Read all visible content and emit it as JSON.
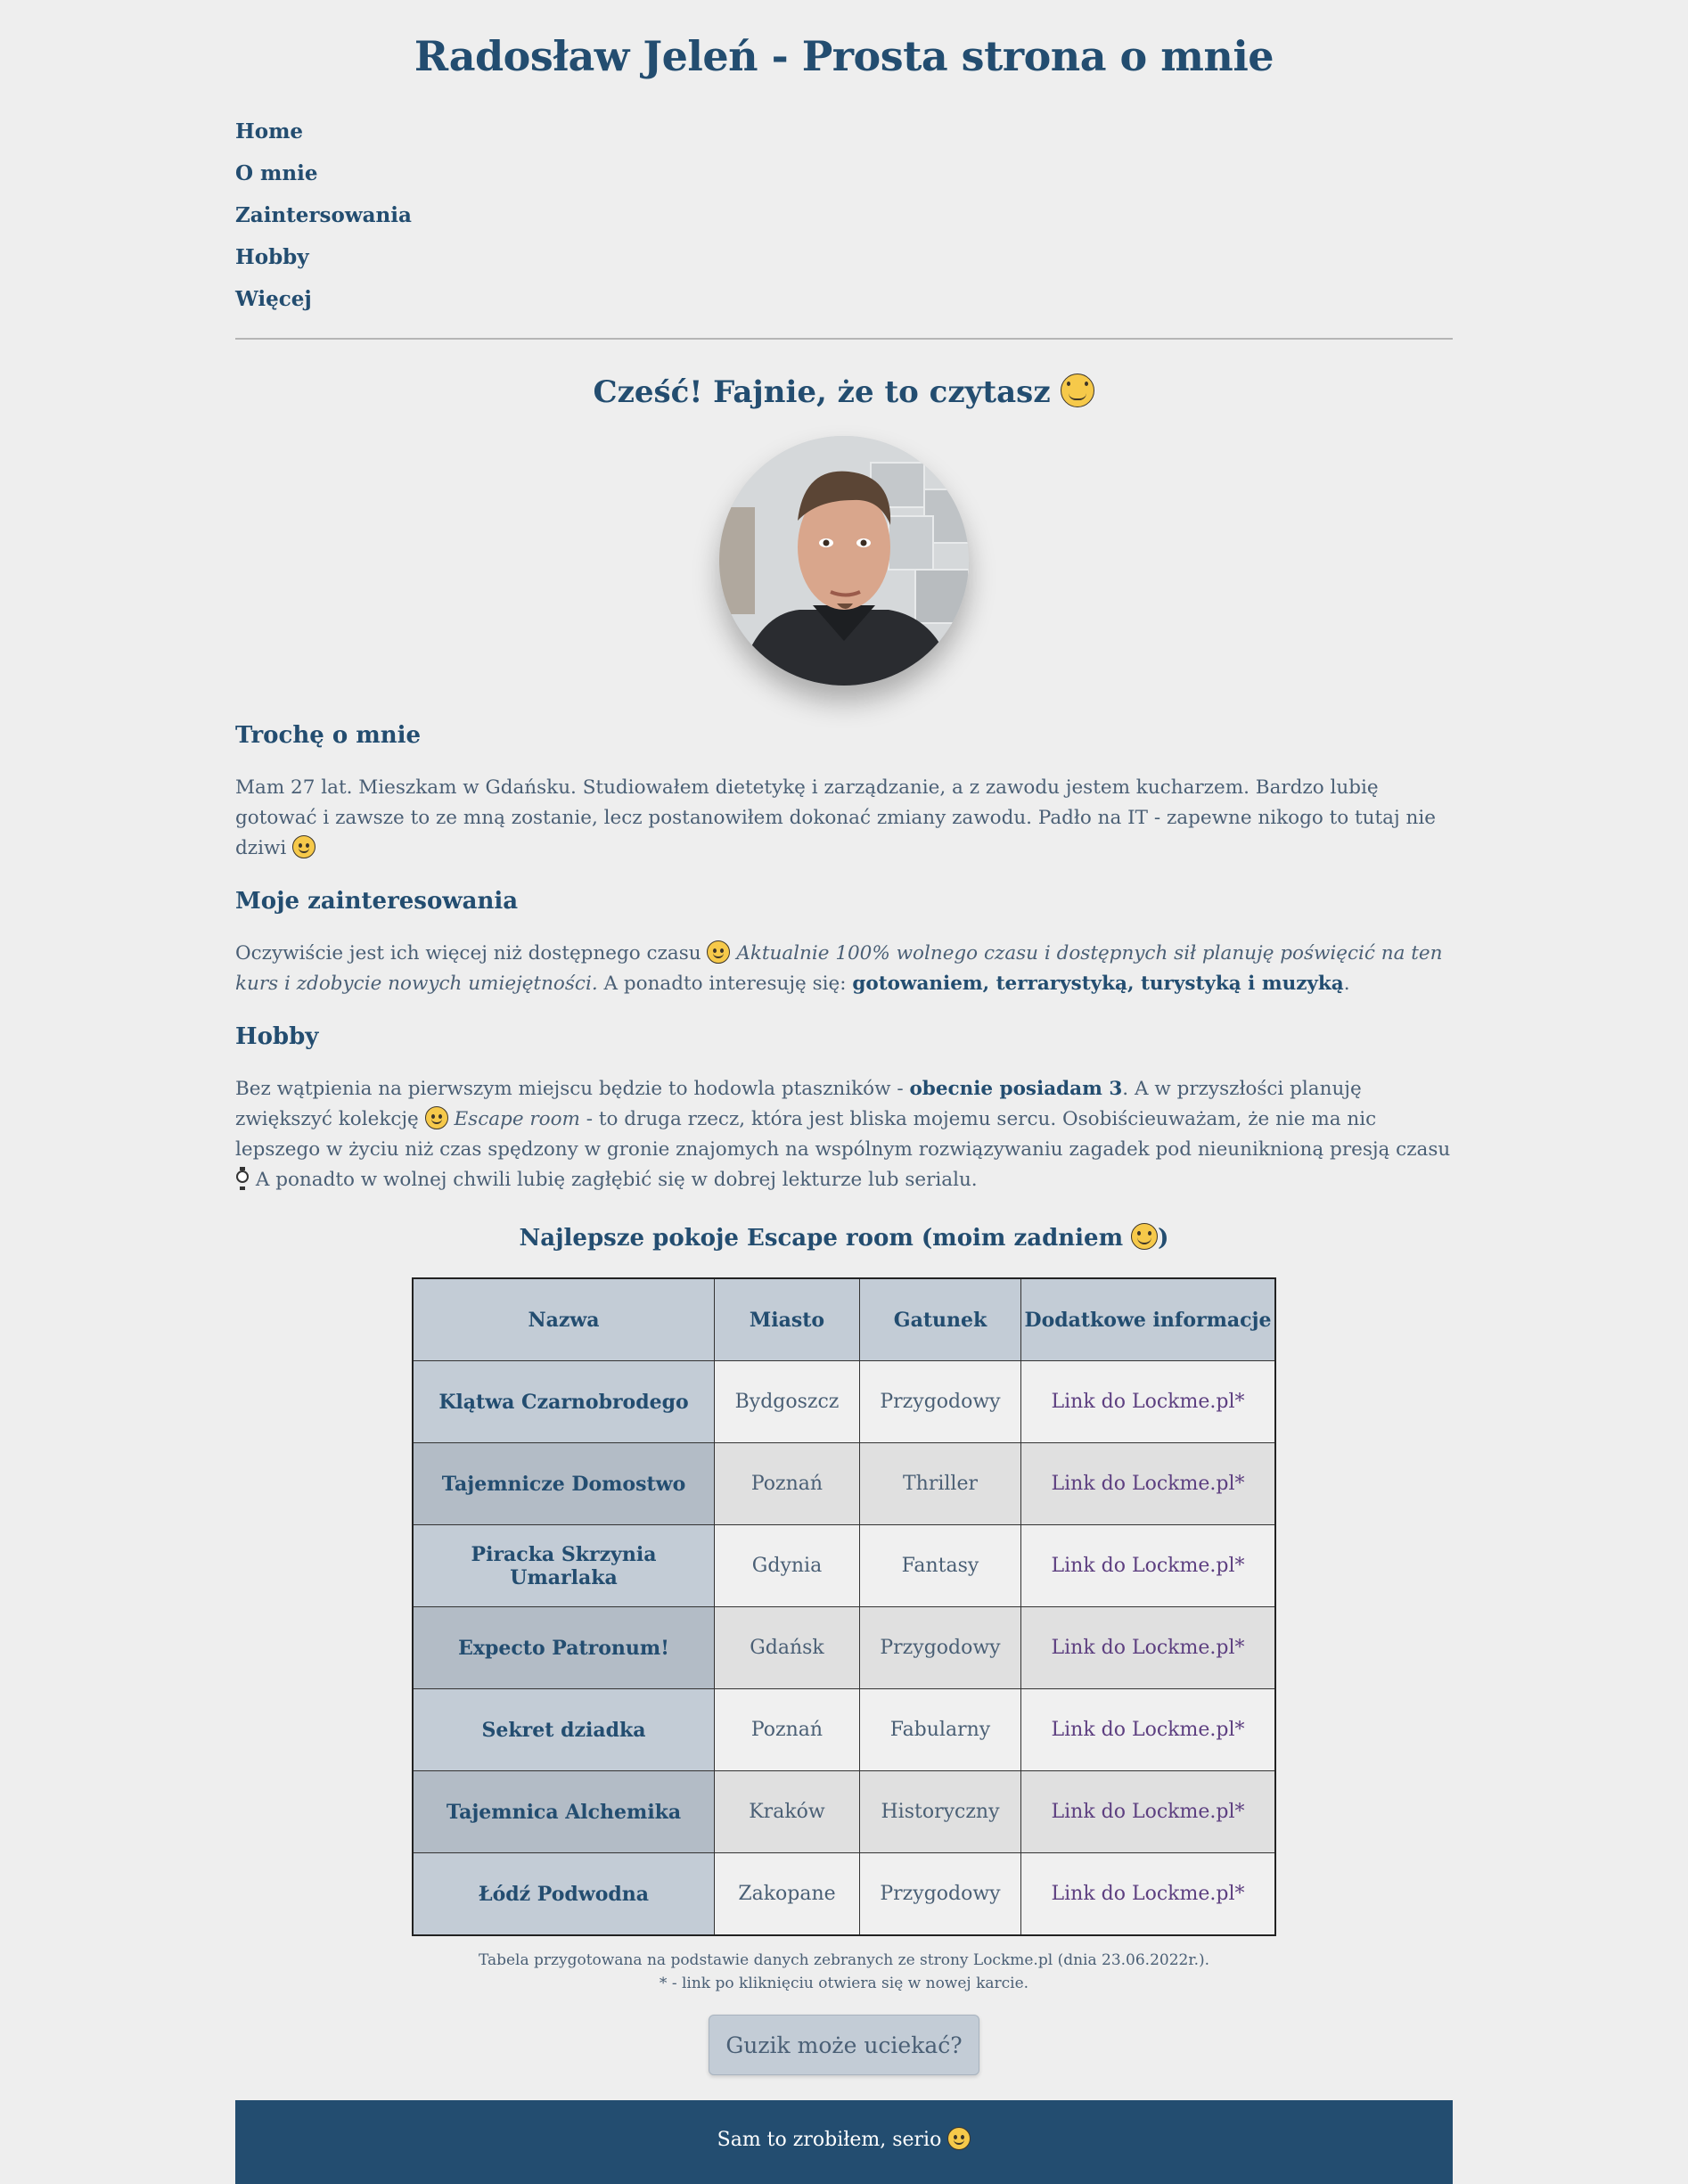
{
  "header": {
    "title": "Radosław Jeleń - Prosta strona o mnie"
  },
  "nav": {
    "items": [
      {
        "label": "Home"
      },
      {
        "label": "O mnie"
      },
      {
        "label": "Zaintersowania"
      },
      {
        "label": "Hobby"
      },
      {
        "label": "Więcej"
      }
    ]
  },
  "greeting": {
    "text": "Cześć! Fajnie, że to czytasz",
    "emoji": "grinning-face"
  },
  "about": {
    "heading": "Trochę o mnie",
    "text": "Mam 27 lat. Mieszkam w Gdańsku. Studiowałem dietetykę i zarządzanie, a z zawodu jestem kucharzem. Bardzo lubię gotować i zawsze to ze mną zostanie, lecz postanowiłem dokonać zmiany zawodu. Padło na IT - zapewne nikogo to tutaj nie dziwi"
  },
  "interests": {
    "heading": "Moje zainteresowania",
    "text_start": "Oczywiście jest ich więcej niż dostępnego czasu",
    "text_italic": "Aktualnie 100% wolnego czasu i dostępnych sił planuję poświęcić na ten kurs i zdobycie nowych umiejętności.",
    "text_mid": "A ponadto interesuję się:",
    "text_bold": "gotowaniem, terrarystyką, turystyką i muzyką",
    "text_end": "."
  },
  "hobby": {
    "heading": "Hobby",
    "t1": "Bez wątpienia na pierwszym miejscu będzie to hodowla ptaszników -",
    "t1_bold": "obecnie posiadam 3",
    "t2": ". A w przyszłości planuję zwiększyć kolekcję",
    "t3_italic": "Escape room",
    "t4": "- to druga rzecz, która jest bliska mojemu sercu. Osobiścieuważam, że nie ma nic lepszego w życiu niż czas spędzony w gronie znajomych na wspólnym rozwiązywaniu zagadek pod nieuniknioną presją czasu",
    "t5": "A ponadto w wolnej chwili lubię zagłębić się w dobrej lekturze lub serialu."
  },
  "table": {
    "caption": "Najlepsze pokoje Escape room (moim zadniem",
    "caption_end": ")",
    "headers": [
      "Nazwa",
      "Miasto",
      "Gatunek",
      "Dodatkowe informacje"
    ],
    "rows": [
      {
        "name": "Klątwa Czarnobrodego",
        "city": "Bydgoszcz",
        "genre": "Przygodowy",
        "link": "Link do Lockme.pl*"
      },
      {
        "name": "Tajemnicze Domostwo",
        "city": "Poznań",
        "genre": "Thriller",
        "link": "Link do Lockme.pl*"
      },
      {
        "name": "Piracka Skrzynia Umarlaka",
        "city": "Gdynia",
        "genre": "Fantasy",
        "link": "Link do Lockme.pl*"
      },
      {
        "name": "Expecto Patronum!",
        "city": "Gdańsk",
        "genre": "Przygodowy",
        "link": "Link do Lockme.pl*"
      },
      {
        "name": "Sekret dziadka",
        "city": "Poznań",
        "genre": "Fabularny",
        "link": "Link do Lockme.pl*"
      },
      {
        "name": "Tajemnica Alchemika",
        "city": "Kraków",
        "genre": "Historyczny",
        "link": "Link do Lockme.pl*"
      },
      {
        "name": "Łódź Podwodna",
        "city": "Zakopane",
        "genre": "Przygodowy",
        "link": "Link do Lockme.pl*"
      }
    ],
    "note1": "Tabela przygotowana na podstawie danych zebranych ze strony Lockme.pl (dnia 23.06.2022r.).",
    "note2": "* - link po kliknięciu otwiera się w nowej karcie."
  },
  "button": {
    "label": "Guzik może uciekać?"
  },
  "footer": {
    "text": "Sam to zrobiłem, serio"
  },
  "colors": {
    "primary": "#234d70",
    "background": "#eeeeee",
    "link": "#5d3f80",
    "table_header": "#c3ccd6"
  }
}
